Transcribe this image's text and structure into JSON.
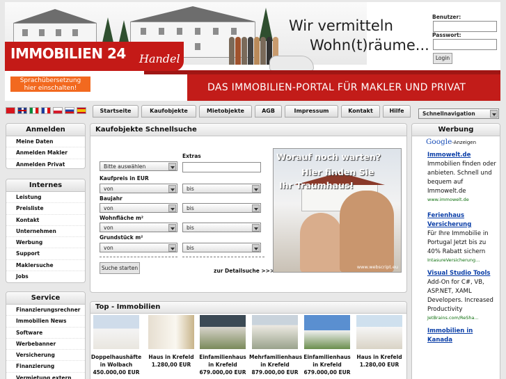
{
  "header": {
    "logo_main": "IMMOBILIEN",
    "logo_num": "24",
    "logo_sub": "Handel",
    "slogan_line1": "Wir vermitteln",
    "slogan_line2": "Wohn(t)räume...",
    "portal_text": "DAS IMMOBILIEN-PORTAL FÜR MAKLER UND PRIVAT",
    "translation_line1": "Sprachübersetzung",
    "translation_line2": "hier einschalten!"
  },
  "login": {
    "user_label": "Benutzer:",
    "password_label": "Passwort:",
    "button": "Login"
  },
  "flags": [
    "turkey",
    "uk",
    "italy",
    "france",
    "poland",
    "russia",
    "spain"
  ],
  "nav": {
    "tabs": [
      "Startseite",
      "Kaufobjekte",
      "Mietobjekte",
      "AGB",
      "Impressum",
      "Kontakt",
      "Hilfe"
    ],
    "quicknav": "Schnellnavigation"
  },
  "left": {
    "anmelden": {
      "title": "Anmelden",
      "items": [
        "Meine Daten",
        "Anmelden Makler",
        "Anmelden Privat"
      ]
    },
    "internes": {
      "title": "Internes",
      "items": [
        "Leistung",
        "Preisliste",
        "Kontakt",
        "Unternehmen",
        "Werbung",
        "Support",
        "Maklersuche",
        "Jobs"
      ]
    },
    "service": {
      "title": "Service",
      "items": [
        "Finanzierungsrechner",
        "Immobilien News",
        "Software",
        "Werbebanner",
        "Versicherung",
        "Finanzierung",
        "Vermietung extern"
      ]
    }
  },
  "search": {
    "title": "Kaufobjekte Schnellsuche",
    "extras_label": "Extras",
    "category_select": "Bitte auswählen",
    "price_label": "Kaufpreis in EUR",
    "year_label": "Baujahr",
    "living_label": "Wohnfläche m²",
    "land_label": "Grundstück m²",
    "from": "von",
    "to": "bis",
    "search_button": "Suche starten",
    "detail_link": "zur Detailsuche >>>"
  },
  "promo": {
    "line1": "Worauf noch warten?",
    "line2": "Hier finden Sie",
    "line3": "Ihr Traumhaus!",
    "watermark": "www.webscript.eu"
  },
  "top": {
    "title": "Top - Immobilien",
    "items": [
      {
        "name": "Doppelhaushäfte in Wolbach",
        "price": "450.000,00 EUR"
      },
      {
        "name": "Haus in Krefeld",
        "price": "1.280,00 EUR"
      },
      {
        "name": "Einfamilienhaus in Krefeld",
        "price": "679.000,00 EUR"
      },
      {
        "name": "Mehrfamilienhaus in Krefeld",
        "price": "879.000,00 EUR"
      },
      {
        "name": "Einfamilienhaus in Krefeld",
        "price": "679.000,00 EUR"
      },
      {
        "name": "Haus in Krefeld",
        "price": "1.280,00 EUR"
      }
    ]
  },
  "ads": {
    "title": "Werbung",
    "google": "Google",
    "google_suffix": "-Anzeigen",
    "list": [
      {
        "title": "Immowelt.de",
        "text": "Immobilien finden oder anbieten. Schnell und bequem auf Immowelt.de",
        "url": "www.immowelt.de"
      },
      {
        "title": "Ferienhaus Versicherung",
        "text": "Für Ihre Immobilie in Portugal Jetzt bis zu 40% Rabatt sichern",
        "url": "IntasureVersicherung..."
      },
      {
        "title": "Visual Studio Tools",
        "text": "Add-On for C#, VB, ASP.NET, XAML Developers. Increased Productivity",
        "url": "JetBrains.com/ReSha..."
      },
      {
        "title": "Immobilien in Kanada",
        "text": "",
        "url": ""
      }
    ]
  }
}
